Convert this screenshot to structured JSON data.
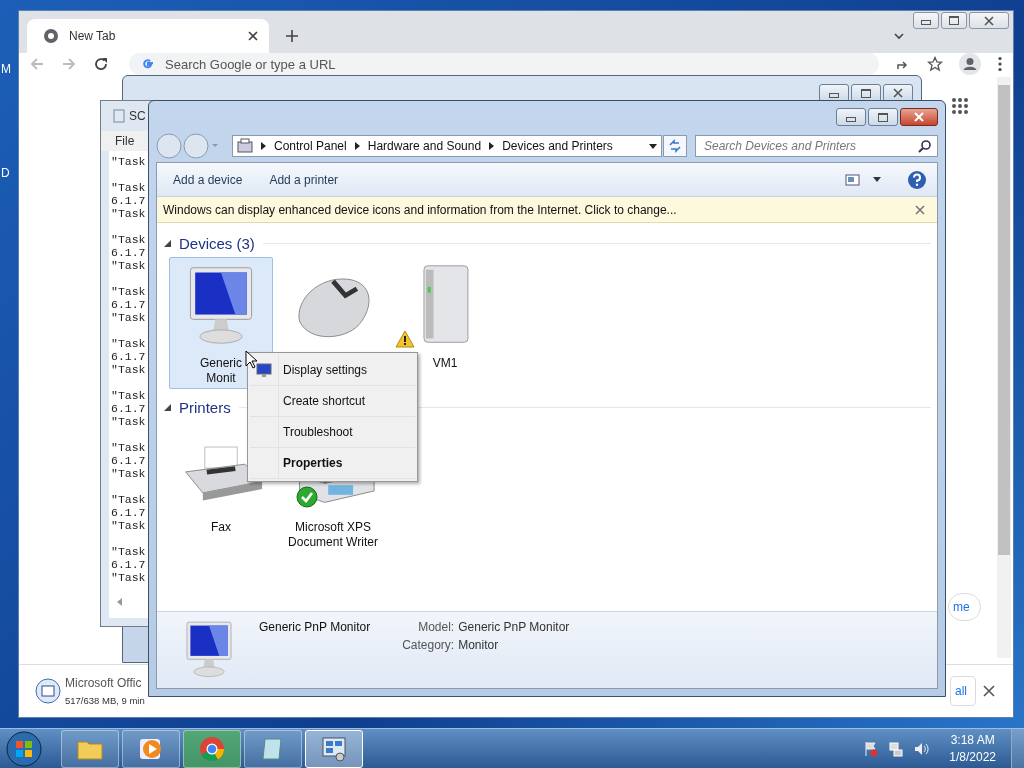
{
  "desktop": {
    "icon_labels": [
      "M",
      "D"
    ]
  },
  "chrome": {
    "tab": {
      "title": "New Tab",
      "selected": true
    },
    "address": {
      "placeholder": "Search Google or type a URL"
    },
    "side_button": "me",
    "download": {
      "name": "Microsoft Offic",
      "progress": "517/638 MB, 9 min"
    },
    "show_all_button": "all"
  },
  "notepad": {
    "title": "SC",
    "menu": [
      "File"
    ],
    "first_line": "\"Task",
    "blocks": [
      [
        "\"Task",
        "6.1.7",
        "\"Task"
      ],
      [
        "\"Task",
        "6.1.7",
        "\"Task"
      ],
      [
        "\"Task",
        "6.1.7",
        "\"Task"
      ],
      [
        "\"Task",
        "6.1.7",
        "\"Task"
      ],
      [
        "\"Task",
        "6.1.7",
        "\"Task"
      ],
      [
        "\"Task",
        "6.1.7",
        "\"Task"
      ],
      [
        "\"Task",
        "6.1.7",
        "\"Task"
      ],
      [
        "\"Task",
        "6.1.7",
        "\"Task"
      ]
    ]
  },
  "devices_window": {
    "breadcrumbs": [
      "Control Panel",
      "Hardware and Sound",
      "Devices and Printers"
    ],
    "search": {
      "placeholder": "Search Devices and Printers"
    },
    "toolbar": [
      "Add a device",
      "Add a printer"
    ],
    "infobar": "Windows can display enhanced device icons and information from the Internet. Click to change...",
    "groups": [
      {
        "title": "Devices (3)",
        "expanded": true,
        "items": [
          {
            "kind": "monitor",
            "label_lines": [
              "Generic",
              "Monit"
            ],
            "selected": true,
            "warning": false,
            "default": false
          },
          {
            "kind": "mouse",
            "selected": false,
            "warning": false,
            "default": false
          },
          {
            "kind": "drive",
            "label_lines": [
              "VM1"
            ],
            "selected": false,
            "warning": true,
            "default": false
          }
        ]
      },
      {
        "title": "Printers",
        "expanded": true,
        "items": [
          {
            "kind": "fax",
            "label_lines": [
              "Fax"
            ],
            "selected": false,
            "warning": false,
            "default": false
          },
          {
            "kind": "printer",
            "label_lines": [
              "Microsoft XPS",
              "Document Writer"
            ],
            "selected": false,
            "warning": false,
            "default": true
          }
        ]
      }
    ],
    "details": {
      "name": "Generic PnP Monitor",
      "fields": [
        {
          "label": "Model:",
          "value": "Generic PnP Monitor"
        },
        {
          "label": "Category:",
          "value": "Monitor"
        }
      ]
    }
  },
  "context_menu": [
    {
      "label": "Display settings",
      "kind": "display",
      "default": false
    },
    {
      "label": "Create shortcut",
      "kind": "plain",
      "default": false
    },
    {
      "label": "Troubleshoot",
      "kind": "plain",
      "default": false
    },
    {
      "label": "Properties",
      "kind": "plain",
      "default": true
    }
  ],
  "taskbar": {
    "buttons": [
      {
        "kind": "folder",
        "active": false
      },
      {
        "kind": "media",
        "active": false
      },
      {
        "kind": "chrome",
        "active": false
      },
      {
        "kind": "notepad",
        "active": false
      },
      {
        "kind": "control-panel",
        "active": true
      }
    ],
    "time": "3:18 AM",
    "date": "1/8/2022"
  }
}
